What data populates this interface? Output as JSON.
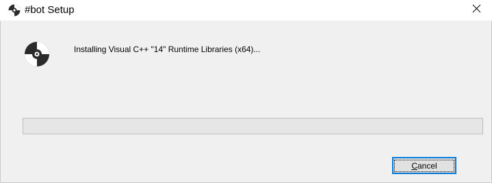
{
  "window": {
    "title": "#bot Setup",
    "icon": "cd-icon",
    "close_glyph": "✕"
  },
  "install": {
    "status_text": "Installing Visual C++ \"14\" Runtime Libraries (x64)...",
    "icon": "cd-icon",
    "progress": 0
  },
  "buttons": {
    "cancel_mnemonic": "C",
    "cancel_rest": "ancel"
  },
  "colors": {
    "accent": "#0078d7",
    "background": "#f0f0f0"
  }
}
